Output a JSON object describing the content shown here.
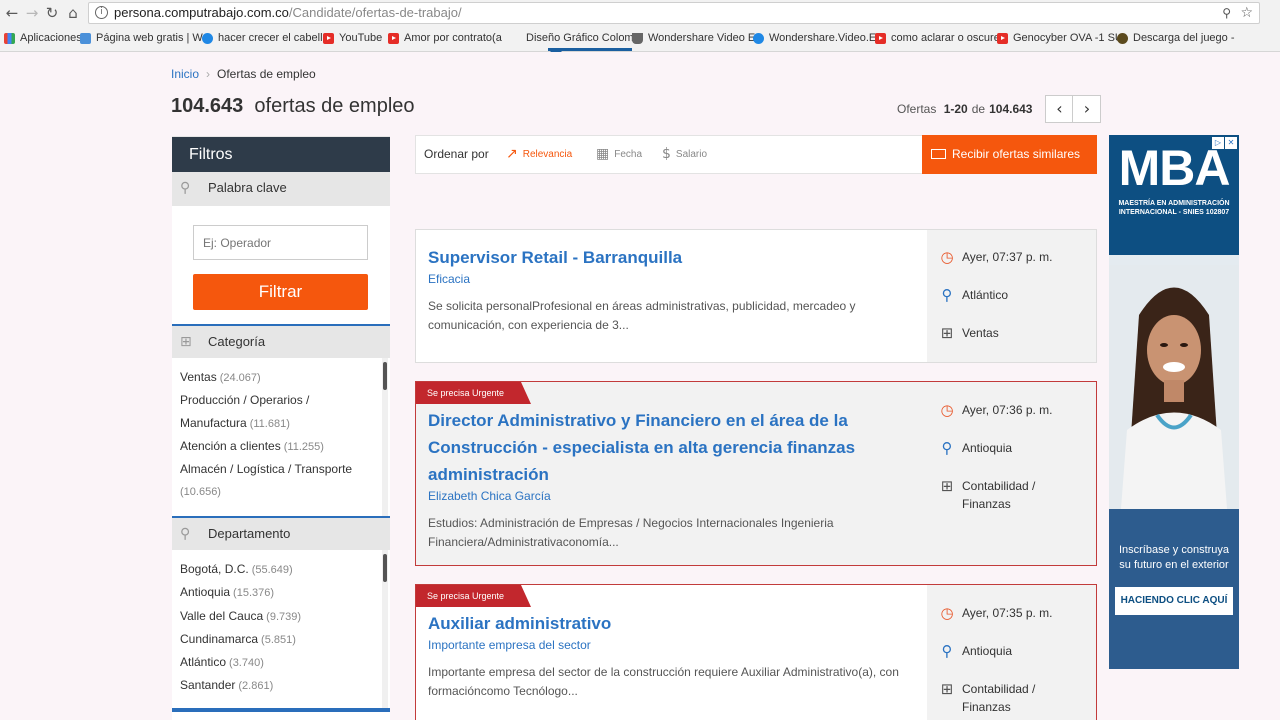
{
  "browser": {
    "url_host": "persona.computrabajo.com.co",
    "url_path": "/Candidate/ofertas-de-trabajo/",
    "bookmarks": [
      {
        "label": "Aplicaciones",
        "icon": "apps-grid-icon"
      },
      {
        "label": "Página web gratis | W",
        "icon": "wix-icon"
      },
      {
        "label": "hacer crecer el cabello",
        "icon": "s-icon"
      },
      {
        "label": "YouTube",
        "icon": "youtube-icon"
      },
      {
        "label": "Amor por contrato(a",
        "icon": "youtube-icon"
      },
      {
        "label": "Diseño Gráfico Colom",
        "icon": "none"
      },
      {
        "label": "Wondershare Video E",
        "icon": "cup-icon"
      },
      {
        "label": "Wondershare.Video.E",
        "icon": "globe-icon"
      },
      {
        "label": "como aclarar o oscure",
        "icon": "youtube-icon"
      },
      {
        "label": "Genocyber OVA -1 SU",
        "icon": "youtube-icon"
      },
      {
        "label": "Descarga del juego - ",
        "icon": "game-icon"
      }
    ]
  },
  "breadcrumb": {
    "home": "Inicio",
    "current": "Ofertas de empleo"
  },
  "header": {
    "count": "104.643",
    "title_suffix": "ofertas de empleo"
  },
  "pager": {
    "label": "Ofertas",
    "range": "1-20",
    "of": "de",
    "total": "104.643"
  },
  "sidebar": {
    "title": "Filtros",
    "keyword": {
      "label": "Palabra clave",
      "placeholder": "Ej: Operador",
      "button": "Filtrar"
    },
    "categoria": {
      "label": "Categoría",
      "items": [
        {
          "name": "Ventas",
          "count": "(24.067)"
        },
        {
          "name": "Producción / Operarios / Manufactura",
          "count": "(11.681)"
        },
        {
          "name": "Atención a clientes",
          "count": "(11.255)"
        },
        {
          "name": "Almacén / Logística / Transporte",
          "count": "(10.656)"
        }
      ]
    },
    "departamento": {
      "label": "Departamento",
      "items": [
        {
          "name": "Bogotá, D.C.",
          "count": "(55.649)"
        },
        {
          "name": "Antioquia",
          "count": "(15.376)"
        },
        {
          "name": "Valle del Cauca",
          "count": "(9.739)"
        },
        {
          "name": "Cundinamarca",
          "count": "(5.851)"
        },
        {
          "name": "Atlántico",
          "count": "(3.740)"
        },
        {
          "name": "Santander",
          "count": "(2.861)"
        }
      ]
    }
  },
  "sort": {
    "label": "Ordenar por",
    "options": [
      "Relevancia",
      "Fecha",
      "Salario"
    ],
    "active": "Relevancia",
    "subscribe": "Recibir ofertas similares"
  },
  "offers": [
    {
      "urgent_label": "",
      "title": "Supervisor Retail - Barranquilla",
      "company": "Eficacia",
      "description": "Se solicita personalProfesional en áreas administrativas, publicidad, mercadeo y comunicación, con experiencia de 3...",
      "date": "Ayer, 07:37 p. m.",
      "location": "Atlántico",
      "category": "Ventas"
    },
    {
      "urgent_label": "Se precisa Urgente",
      "title": "Director Administrativo y Financiero en el área de la Construcción - especialista en alta gerencia finanzas administración",
      "company": "Elizabeth Chica García",
      "description": "Estudios: Administración de Empresas / Negocios Internacionales Ingenieria Financiera/Administrativaconomía...",
      "date": "Ayer, 07:36 p. m.",
      "location": "Antioquia",
      "category": "Contabilidad / Finanzas"
    },
    {
      "urgent_label": "Se precisa Urgente",
      "title": "Auxiliar administrativo",
      "company": "Importante empresa del sector",
      "description": "Importante empresa del sector de la construcción requiere Auxiliar Administrativo(a), con formacióncomo Tecnólogo...",
      "date": "Ayer, 07:35 p. m.",
      "location": "Antioquia",
      "category": "Contabilidad / Finanzas"
    }
  ],
  "ad": {
    "headline": "MBA",
    "subline": "MAESTRÍA EN ADMINISTRACIÓN INTERNACIONAL - SNIES 102807",
    "tagline": "Inscríbase y construya su futuro en el exterior",
    "cta": "HACIENDO CLIC AQUÍ"
  },
  "colors": {
    "accent": "#f5570d",
    "link": "#2b73c2",
    "urgent": "#c2272d",
    "sidebar_head": "#2e3b49"
  }
}
